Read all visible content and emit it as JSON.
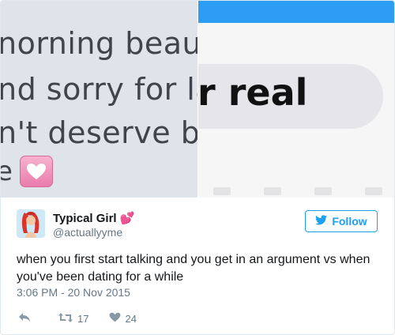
{
  "media": {
    "left_lines": [
      "norning beauti",
      "nd sorry for la",
      "n't deserve ba",
      "e"
    ],
    "right_bubble_text": "r real",
    "heart_icon": "pink-heart-emoji",
    "colors": {
      "left_bg": "#dfe3ea",
      "right_bg": "#f6f6f7",
      "top_bar": "#2d9cf3",
      "bubble": "#e6e6ea"
    }
  },
  "tweet": {
    "display_name": "Typical Girl 💕",
    "handle": "@actuallyyme",
    "follow_label": "Follow",
    "text": "when you first start talking and you get in an argument vs when you've been dating for a while",
    "timestamp": "3:06 PM - 20 Nov 2015",
    "retweets": "17",
    "likes": "24"
  },
  "icons": {
    "follow": "twitter-bird-icon",
    "reply": "reply-icon",
    "retweet": "retweet-icon",
    "like": "heart-icon"
  },
  "colors": {
    "accent": "#1da1f2",
    "muted": "#657786",
    "text": "#14171a"
  }
}
